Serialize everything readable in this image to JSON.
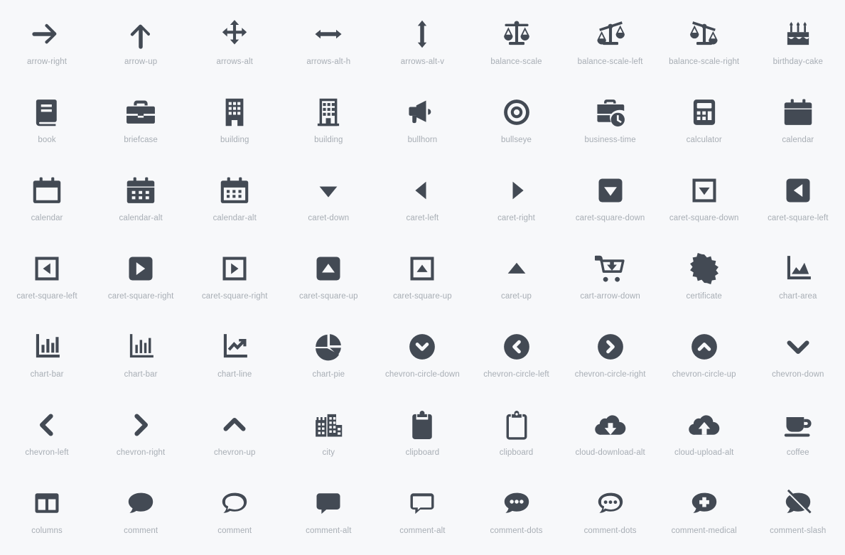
{
  "gallery": {
    "background_color": "#f7f8fa",
    "icon_color": "#434a54",
    "label_color": "#a8aeb5",
    "columns": 9,
    "rows": 7,
    "icons": [
      {
        "name": "arrow-right",
        "label": "arrow-right",
        "style": "solid"
      },
      {
        "name": "arrow-up",
        "label": "arrow-up",
        "style": "solid"
      },
      {
        "name": "arrows-alt",
        "label": "arrows-alt",
        "style": "solid"
      },
      {
        "name": "arrows-alt-h",
        "label": "arrows-alt-h",
        "style": "solid"
      },
      {
        "name": "arrows-alt-v",
        "label": "arrows-alt-v",
        "style": "solid"
      },
      {
        "name": "balance-scale",
        "label": "balance-scale",
        "style": "solid"
      },
      {
        "name": "balance-scale-left",
        "label": "balance-scale-left",
        "style": "solid"
      },
      {
        "name": "balance-scale-right",
        "label": "balance-scale-right",
        "style": "solid"
      },
      {
        "name": "birthday-cake",
        "label": "birthday-cake",
        "style": "solid"
      },
      {
        "name": "book",
        "label": "book",
        "style": "solid"
      },
      {
        "name": "briefcase",
        "label": "briefcase",
        "style": "solid"
      },
      {
        "name": "building",
        "label": "building",
        "style": "solid"
      },
      {
        "name": "building",
        "label": "building",
        "style": "regular"
      },
      {
        "name": "bullhorn",
        "label": "bullhorn",
        "style": "solid"
      },
      {
        "name": "bullseye",
        "label": "bullseye",
        "style": "solid"
      },
      {
        "name": "business-time",
        "label": "business-time",
        "style": "solid"
      },
      {
        "name": "calculator",
        "label": "calculator",
        "style": "solid"
      },
      {
        "name": "calendar",
        "label": "calendar",
        "style": "solid"
      },
      {
        "name": "calendar",
        "label": "calendar",
        "style": "regular"
      },
      {
        "name": "calendar-alt",
        "label": "calendar-alt",
        "style": "solid"
      },
      {
        "name": "calendar-alt",
        "label": "calendar-alt",
        "style": "regular"
      },
      {
        "name": "caret-down",
        "label": "caret-down",
        "style": "solid"
      },
      {
        "name": "caret-left",
        "label": "caret-left",
        "style": "solid"
      },
      {
        "name": "caret-right",
        "label": "caret-right",
        "style": "solid"
      },
      {
        "name": "caret-square-down",
        "label": "caret-square-down",
        "style": "solid"
      },
      {
        "name": "caret-square-down",
        "label": "caret-square-down",
        "style": "regular"
      },
      {
        "name": "caret-square-left",
        "label": "caret-square-left",
        "style": "solid"
      },
      {
        "name": "caret-square-left",
        "label": "caret-square-left",
        "style": "regular"
      },
      {
        "name": "caret-square-right",
        "label": "caret-square-right",
        "style": "solid"
      },
      {
        "name": "caret-square-right",
        "label": "caret-square-right",
        "style": "regular"
      },
      {
        "name": "caret-square-up",
        "label": "caret-square-up",
        "style": "solid"
      },
      {
        "name": "caret-square-up",
        "label": "caret-square-up",
        "style": "regular"
      },
      {
        "name": "caret-up",
        "label": "caret-up",
        "style": "solid"
      },
      {
        "name": "cart-arrow-down",
        "label": "cart-arrow-down",
        "style": "solid"
      },
      {
        "name": "certificate",
        "label": "certificate",
        "style": "solid"
      },
      {
        "name": "chart-area",
        "label": "chart-area",
        "style": "solid"
      },
      {
        "name": "chart-bar",
        "label": "chart-bar",
        "style": "solid"
      },
      {
        "name": "chart-bar",
        "label": "chart-bar",
        "style": "regular"
      },
      {
        "name": "chart-line",
        "label": "chart-line",
        "style": "solid"
      },
      {
        "name": "chart-pie",
        "label": "chart-pie",
        "style": "solid"
      },
      {
        "name": "chevron-circle-down",
        "label": "chevron-circle-down",
        "style": "solid"
      },
      {
        "name": "chevron-circle-left",
        "label": "chevron-circle-left",
        "style": "solid"
      },
      {
        "name": "chevron-circle-right",
        "label": "chevron-circle-right",
        "style": "solid"
      },
      {
        "name": "chevron-circle-up",
        "label": "chevron-circle-up",
        "style": "solid"
      },
      {
        "name": "chevron-down",
        "label": "chevron-down",
        "style": "solid"
      },
      {
        "name": "chevron-left",
        "label": "chevron-left",
        "style": "solid"
      },
      {
        "name": "chevron-right",
        "label": "chevron-right",
        "style": "solid"
      },
      {
        "name": "chevron-up",
        "label": "chevron-up",
        "style": "solid"
      },
      {
        "name": "city",
        "label": "city",
        "style": "solid"
      },
      {
        "name": "clipboard",
        "label": "clipboard",
        "style": "solid"
      },
      {
        "name": "clipboard",
        "label": "clipboard",
        "style": "regular"
      },
      {
        "name": "cloud-download-alt",
        "label": "cloud-download-alt",
        "style": "solid"
      },
      {
        "name": "cloud-upload-alt",
        "label": "cloud-upload-alt",
        "style": "solid"
      },
      {
        "name": "coffee",
        "label": "coffee",
        "style": "solid"
      },
      {
        "name": "columns",
        "label": "columns",
        "style": "solid"
      },
      {
        "name": "comment",
        "label": "comment",
        "style": "solid"
      },
      {
        "name": "comment",
        "label": "comment",
        "style": "regular"
      },
      {
        "name": "comment-alt",
        "label": "comment-alt",
        "style": "solid"
      },
      {
        "name": "comment-alt",
        "label": "comment-alt",
        "style": "regular"
      },
      {
        "name": "comment-dots",
        "label": "comment-dots",
        "style": "solid"
      },
      {
        "name": "comment-dots",
        "label": "comment-dots",
        "style": "regular"
      },
      {
        "name": "comment-medical",
        "label": "comment-medical",
        "style": "solid"
      },
      {
        "name": "comment-slash",
        "label": "comment-slash",
        "style": "solid"
      }
    ]
  }
}
